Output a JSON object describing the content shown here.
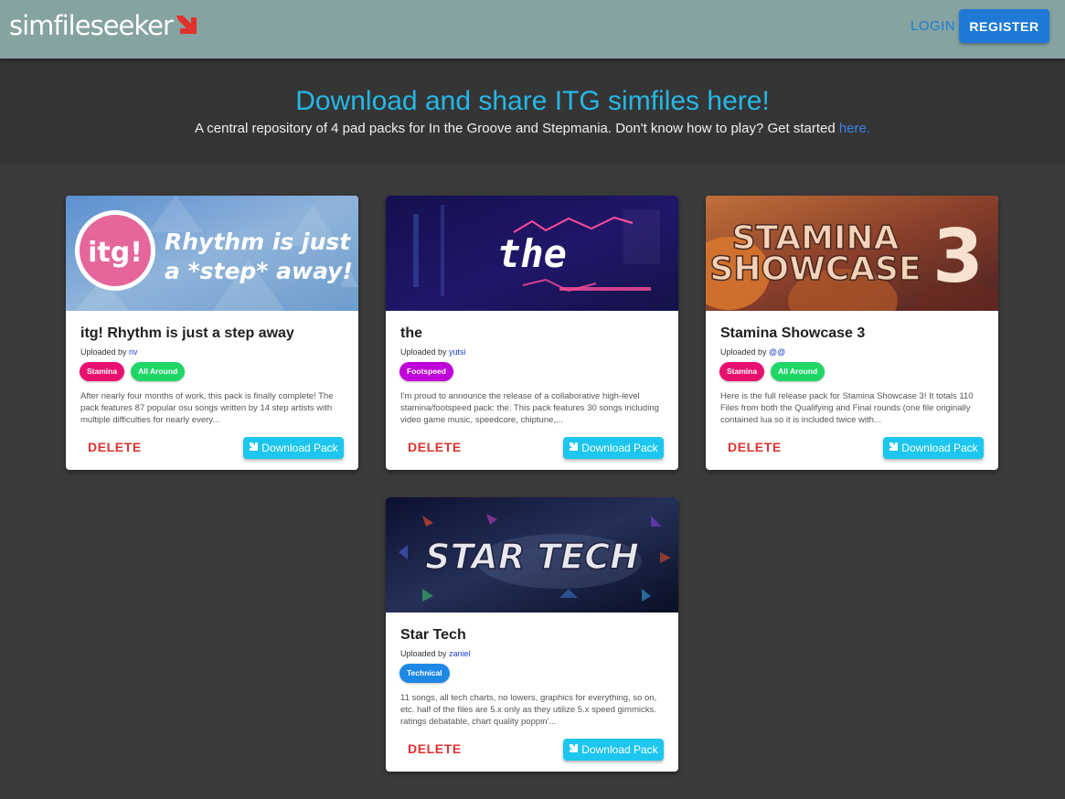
{
  "nav": {
    "logo_text": "simfileseeker",
    "login_label": "LOGIN",
    "register_label": "REGISTER"
  },
  "hero": {
    "title": "Download and share ITG simfiles here!",
    "subtitle": "A central repository of 4 pad packs for In the Groove and Stepmania. Don't know how to play? Get started ",
    "link_text": "here."
  },
  "colors": {
    "accent": "#1e7ad6",
    "hero_title": "#25b8e6",
    "download": "#1cc6ee",
    "delete": "#e03030",
    "tag_stamina": "#e8106e",
    "tag_allaround": "#1fd667",
    "tag_footspeed": "#c000d8",
    "tag_technical": "#1e88e5"
  },
  "packs": [
    {
      "title": "itg! Rhythm is just a step away",
      "banner_text": [
        "itg!",
        "Rhythm is just",
        "a *step* away!"
      ],
      "uploaded_prefix": "Uploaded by ",
      "uploader": "nv",
      "tags": [
        "Stamina",
        "All Around"
      ],
      "description": "After nearly four months of work, this pack is finally complete! The pack features 87 popular osu songs written by 14 step artists with multiple difficulties for nearly every...",
      "delete_label": "DELETE",
      "download_label": "Download Pack"
    },
    {
      "title": "the",
      "banner_text": [
        "the"
      ],
      "uploaded_prefix": "Uploaded by ",
      "uploader": "yutsi",
      "tags": [
        "Footspeed"
      ],
      "description": "I'm proud to announce the release of a collaborative high-level stamina/footspeed pack: the. This pack features 30 songs including video game music, speedcore, chiptune,...",
      "delete_label": "DELETE",
      "download_label": "Download Pack"
    },
    {
      "title": "Stamina Showcase 3",
      "banner_text": [
        "STAMINA",
        "SHOWCASE",
        "3"
      ],
      "uploaded_prefix": "Uploaded by ",
      "uploader": "@@",
      "tags": [
        "Stamina",
        "All Around"
      ],
      "description": "Here is the full release pack for Stamina Showcase 3! It totals 110 Files from both the Qualifying and Final rounds (one file originally contained lua so it is included twice with...",
      "delete_label": "DELETE",
      "download_label": "Download Pack"
    },
    {
      "title": "Star Tech",
      "banner_text": [
        "STAR TECH"
      ],
      "uploaded_prefix": "Uploaded by ",
      "uploader": "zaniel",
      "tags": [
        "Technical"
      ],
      "description": "11 songs, all tech charts, no lowers, graphics for everything, so on, etc. half of the files are 5.x only as they utilize 5.x speed gimmicks. ratings debatable, chart quality poppin'...",
      "delete_label": "DELETE",
      "download_label": "Download Pack"
    }
  ]
}
